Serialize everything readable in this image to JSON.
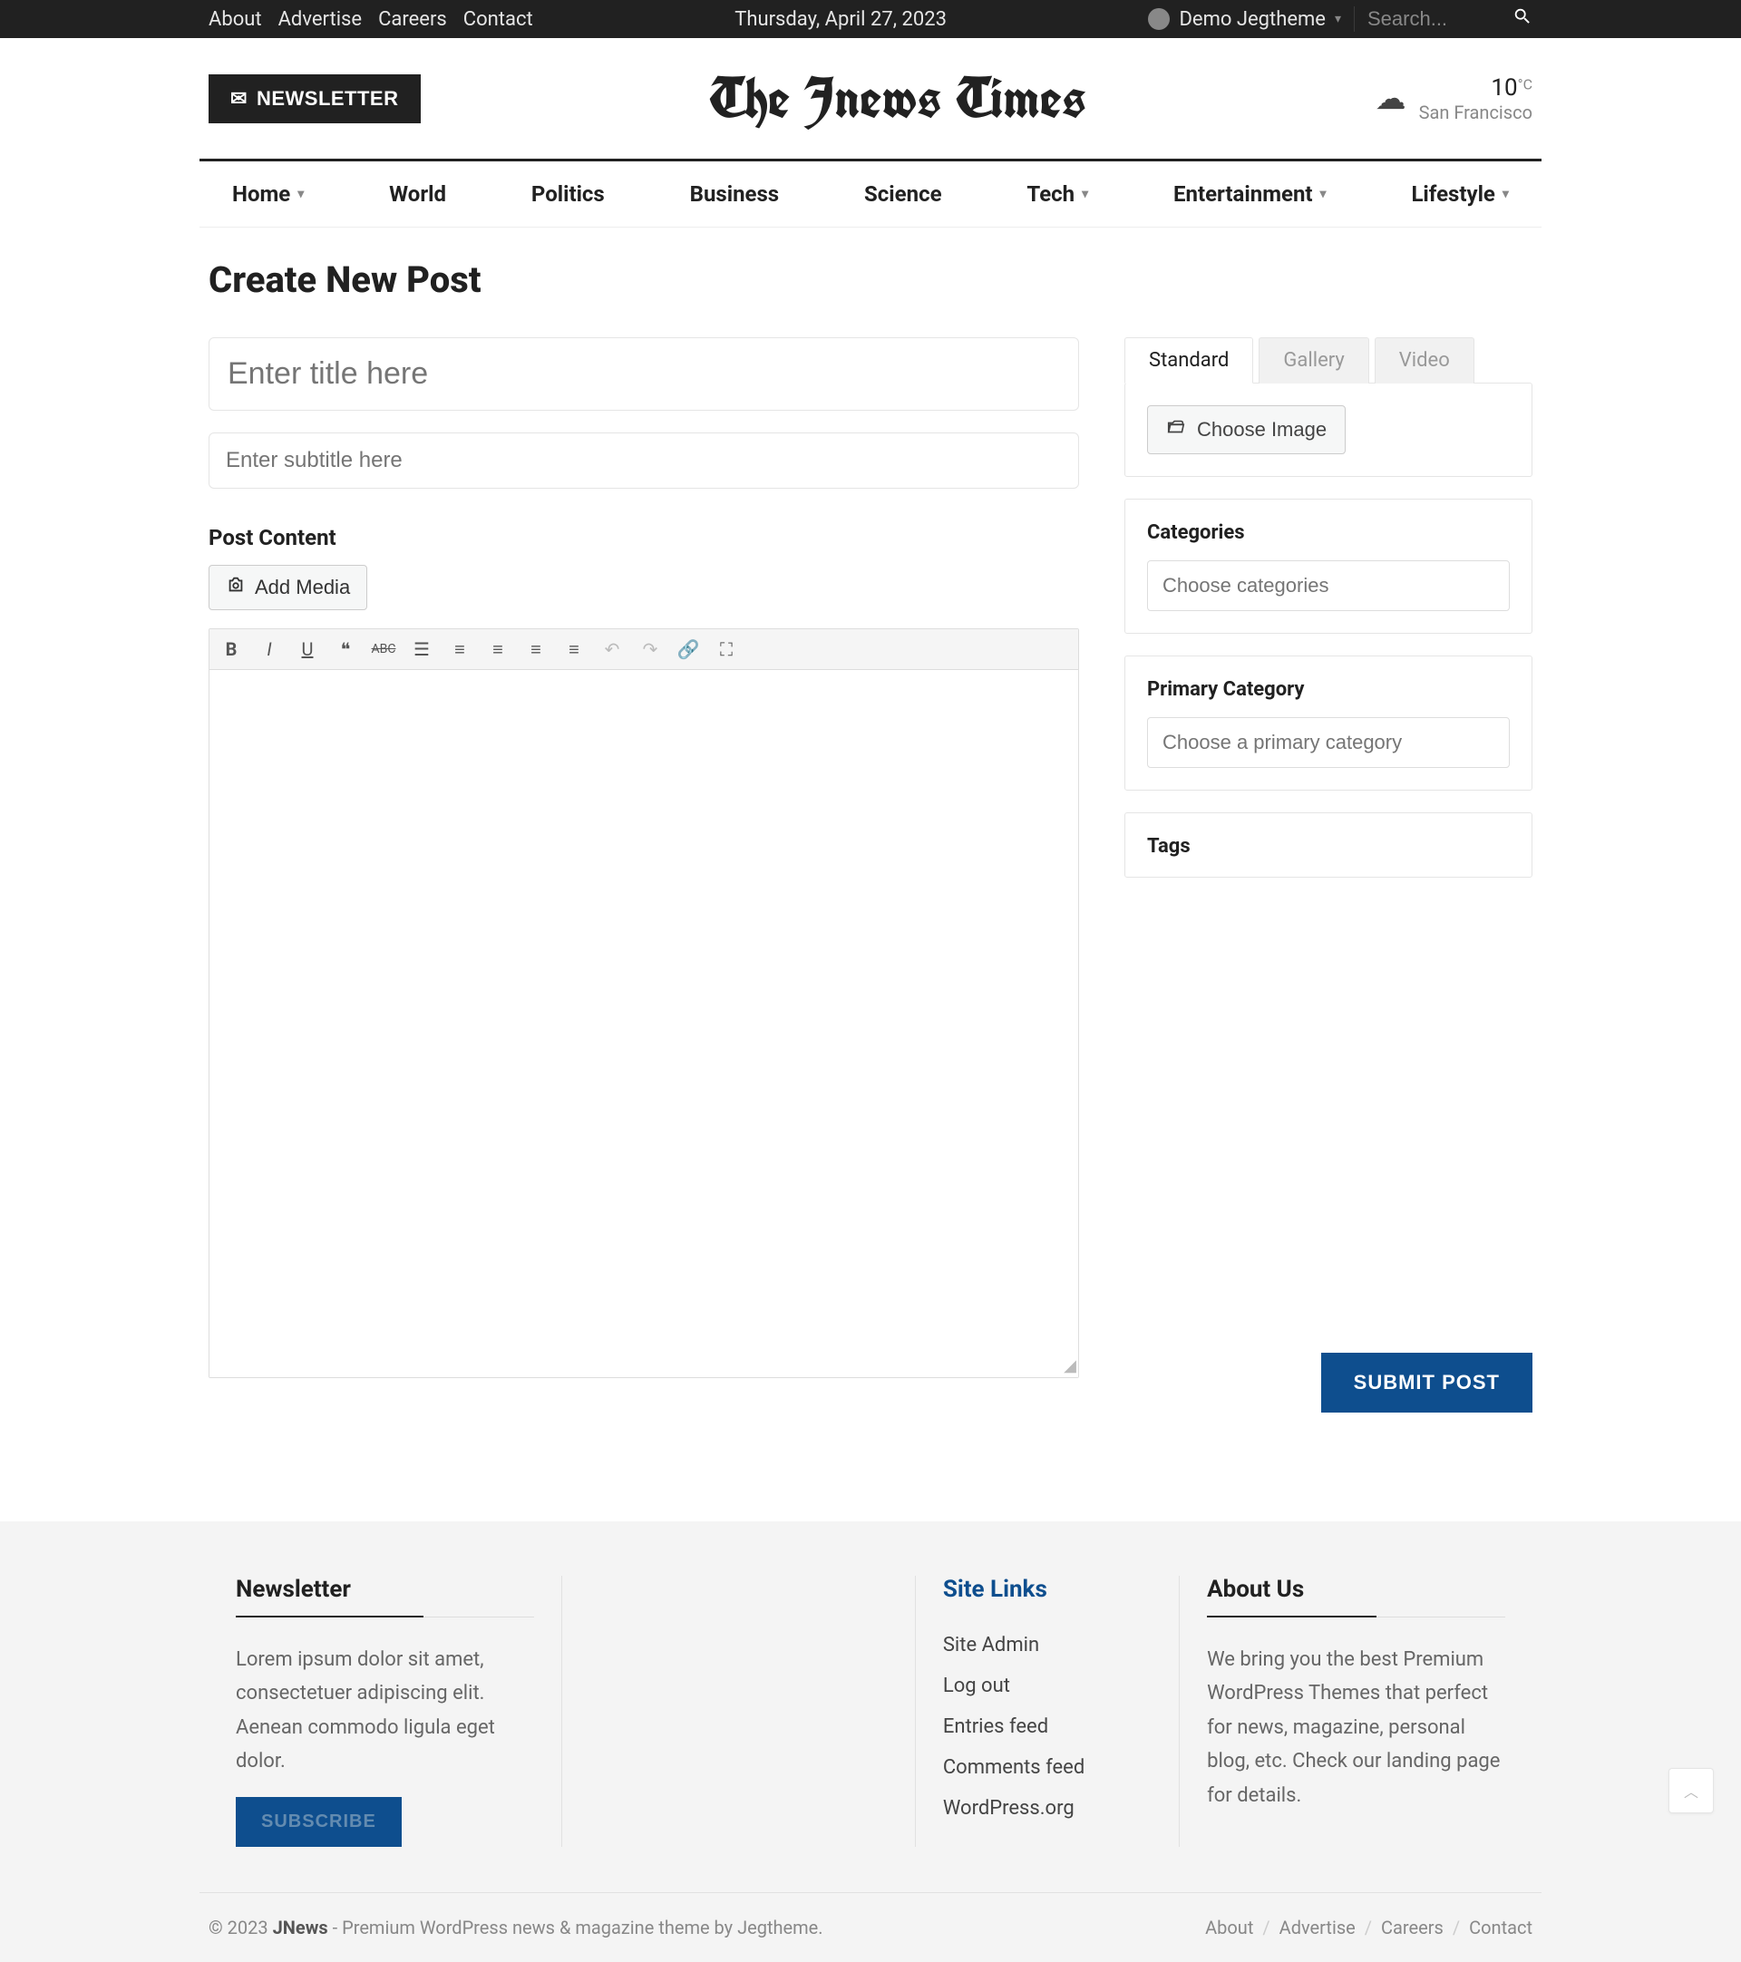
{
  "topbar": {
    "links": [
      "About",
      "Advertise",
      "Careers",
      "Contact"
    ],
    "date": "Thursday, April 27, 2023",
    "user_name": "Demo Jegtheme",
    "search_placeholder": "Search..."
  },
  "header": {
    "newsletter_label": "NEWSLETTER",
    "logo": "The Jnews Times",
    "weather_temp": "10",
    "weather_unit": "°C",
    "weather_city": "San Francisco"
  },
  "nav": {
    "items": [
      {
        "label": "Home",
        "dropdown": true
      },
      {
        "label": "World",
        "dropdown": false
      },
      {
        "label": "Politics",
        "dropdown": false
      },
      {
        "label": "Business",
        "dropdown": false
      },
      {
        "label": "Science",
        "dropdown": false
      },
      {
        "label": "Tech",
        "dropdown": true
      },
      {
        "label": "Entertainment",
        "dropdown": true
      },
      {
        "label": "Lifestyle",
        "dropdown": true
      }
    ]
  },
  "page": {
    "title": "Create New Post",
    "title_placeholder": "Enter title here",
    "subtitle_placeholder": "Enter subtitle here",
    "content_label": "Post Content",
    "add_media_label": "Add Media",
    "submit_label": "SUBMIT POST"
  },
  "sidebar": {
    "tabs": [
      "Standard",
      "Gallery",
      "Video"
    ],
    "choose_image_label": "Choose Image",
    "categories_label": "Categories",
    "categories_placeholder": "Choose categories",
    "primary_label": "Primary Category",
    "primary_placeholder": "Choose a primary category",
    "tags_label": "Tags"
  },
  "footer": {
    "newsletter_title": "Newsletter",
    "newsletter_text": "Lorem ipsum dolor sit amet, consectetuer adipiscing elit. Aenean commodo ligula eget dolor.",
    "subscribe_label": "SUBSCRIBE",
    "site_links_title": "Site Links",
    "site_links": [
      "Site Admin",
      "Log out",
      "Entries feed",
      "Comments feed",
      "WordPress.org"
    ],
    "about_title": "About Us",
    "about_text": "We bring you the best Premium WordPress Themes that perfect for news, magazine, personal blog, etc. Check our landing page for details.",
    "copyright_prefix": "© 2023 ",
    "copyright_brand": "JNews",
    "copyright_mid": " - Premium WordPress news & magazine theme by ",
    "copyright_link": "Jegtheme",
    "bottom_links": [
      "About",
      "Advertise",
      "Careers",
      "Contact"
    ]
  }
}
